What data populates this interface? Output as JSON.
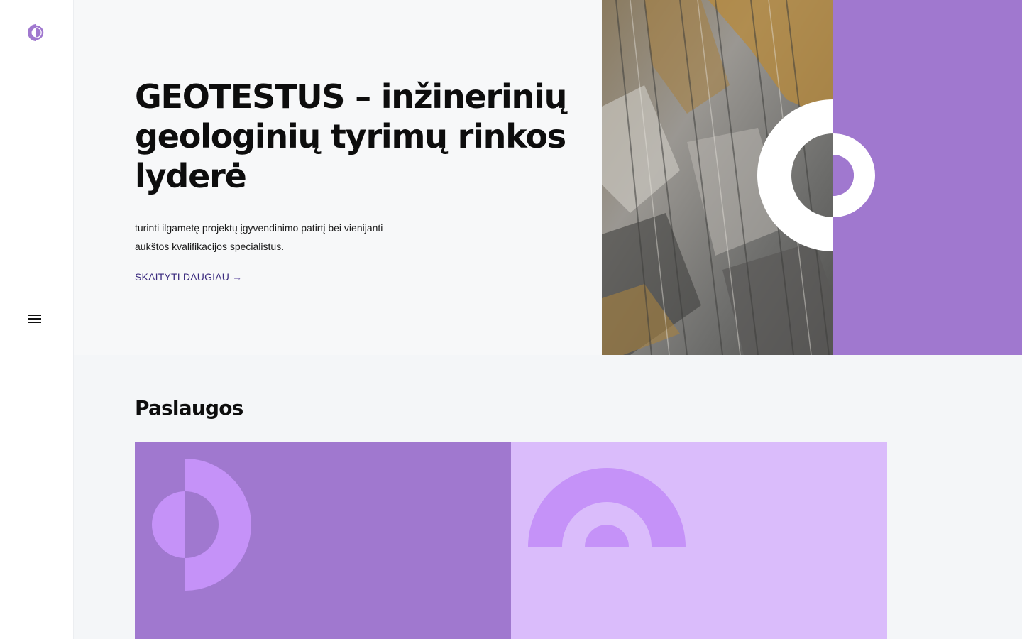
{
  "brand": {
    "logo_icon": "company-logo-icon",
    "accent": "#a078cf",
    "accent_light": "#dabcfb",
    "accent_shape": "#c592f8"
  },
  "sidebar": {
    "menu_icon": "hamburger-menu-icon"
  },
  "hero": {
    "title": "GEOTESTUS – inžinerinių geologinių tyrimų rinkos lyderė",
    "description": "turinti ilgametę projektų įgyvendinimo patirtį bei vienijanti aukštos kvalifikacijos specialistus.",
    "cta_label": "SKAITYTI DAUGIAU",
    "cta_icon": "arrow-right-icon",
    "image": "rock-cliff-photo"
  },
  "services": {
    "heading": "Paslaugos",
    "cards": [
      {
        "icon": "half-circle-ring-shape",
        "background": "#a078cf",
        "title": ""
      },
      {
        "icon": "arch-shape",
        "background": "#dabcfb",
        "title": ""
      }
    ]
  }
}
